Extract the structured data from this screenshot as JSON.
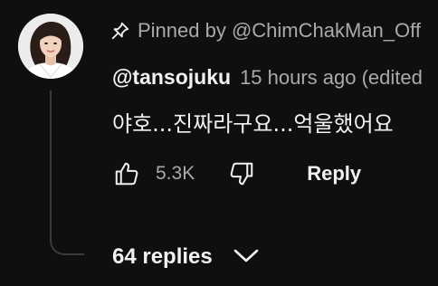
{
  "pinned": {
    "icon": "pin-icon",
    "text": "Pinned by @ChimChakMan_Off"
  },
  "comment": {
    "author": "@tansojuku",
    "timestamp": "15 hours ago (edited",
    "body": "야호...진짜라구요...억울했어요",
    "avatar_icon": "avatar"
  },
  "actions": {
    "like_icon": "thumbs-up-icon",
    "like_count": "5.3K",
    "dislike_icon": "thumbs-down-icon",
    "reply_label": "Reply"
  },
  "replies": {
    "label": "64 replies",
    "icon": "chevron-down-icon"
  },
  "colors": {
    "background": "#0f0f0f",
    "primary_text": "#f1f1f1",
    "secondary_text": "#aaaaaa",
    "thread_line": "#3a3a3a"
  }
}
